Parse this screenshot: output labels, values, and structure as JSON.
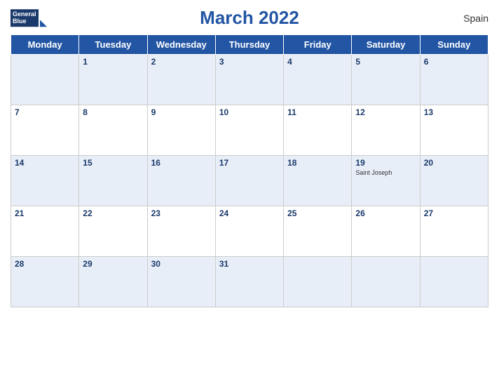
{
  "header": {
    "title": "March 2022",
    "country": "Spain",
    "logo": {
      "general": "General",
      "blue": "Blue"
    }
  },
  "weekdays": [
    "Monday",
    "Tuesday",
    "Wednesday",
    "Thursday",
    "Friday",
    "Saturday",
    "Sunday"
  ],
  "weeks": [
    [
      {
        "num": "",
        "empty": true
      },
      {
        "num": "1",
        "empty": false,
        "event": ""
      },
      {
        "num": "2",
        "empty": false,
        "event": ""
      },
      {
        "num": "3",
        "empty": false,
        "event": ""
      },
      {
        "num": "4",
        "empty": false,
        "event": ""
      },
      {
        "num": "5",
        "empty": false,
        "event": ""
      },
      {
        "num": "6",
        "empty": false,
        "event": ""
      }
    ],
    [
      {
        "num": "7",
        "empty": false,
        "event": ""
      },
      {
        "num": "8",
        "empty": false,
        "event": ""
      },
      {
        "num": "9",
        "empty": false,
        "event": ""
      },
      {
        "num": "10",
        "empty": false,
        "event": ""
      },
      {
        "num": "11",
        "empty": false,
        "event": ""
      },
      {
        "num": "12",
        "empty": false,
        "event": ""
      },
      {
        "num": "13",
        "empty": false,
        "event": ""
      }
    ],
    [
      {
        "num": "14",
        "empty": false,
        "event": ""
      },
      {
        "num": "15",
        "empty": false,
        "event": ""
      },
      {
        "num": "16",
        "empty": false,
        "event": ""
      },
      {
        "num": "17",
        "empty": false,
        "event": ""
      },
      {
        "num": "18",
        "empty": false,
        "event": ""
      },
      {
        "num": "19",
        "empty": false,
        "event": "Saint Joseph"
      },
      {
        "num": "20",
        "empty": false,
        "event": ""
      }
    ],
    [
      {
        "num": "21",
        "empty": false,
        "event": ""
      },
      {
        "num": "22",
        "empty": false,
        "event": ""
      },
      {
        "num": "23",
        "empty": false,
        "event": ""
      },
      {
        "num": "24",
        "empty": false,
        "event": ""
      },
      {
        "num": "25",
        "empty": false,
        "event": ""
      },
      {
        "num": "26",
        "empty": false,
        "event": ""
      },
      {
        "num": "27",
        "empty": false,
        "event": ""
      }
    ],
    [
      {
        "num": "28",
        "empty": false,
        "event": ""
      },
      {
        "num": "29",
        "empty": false,
        "event": ""
      },
      {
        "num": "30",
        "empty": false,
        "event": ""
      },
      {
        "num": "31",
        "empty": false,
        "event": ""
      },
      {
        "num": "",
        "empty": true
      },
      {
        "num": "",
        "empty": true
      },
      {
        "num": "",
        "empty": true
      }
    ]
  ]
}
